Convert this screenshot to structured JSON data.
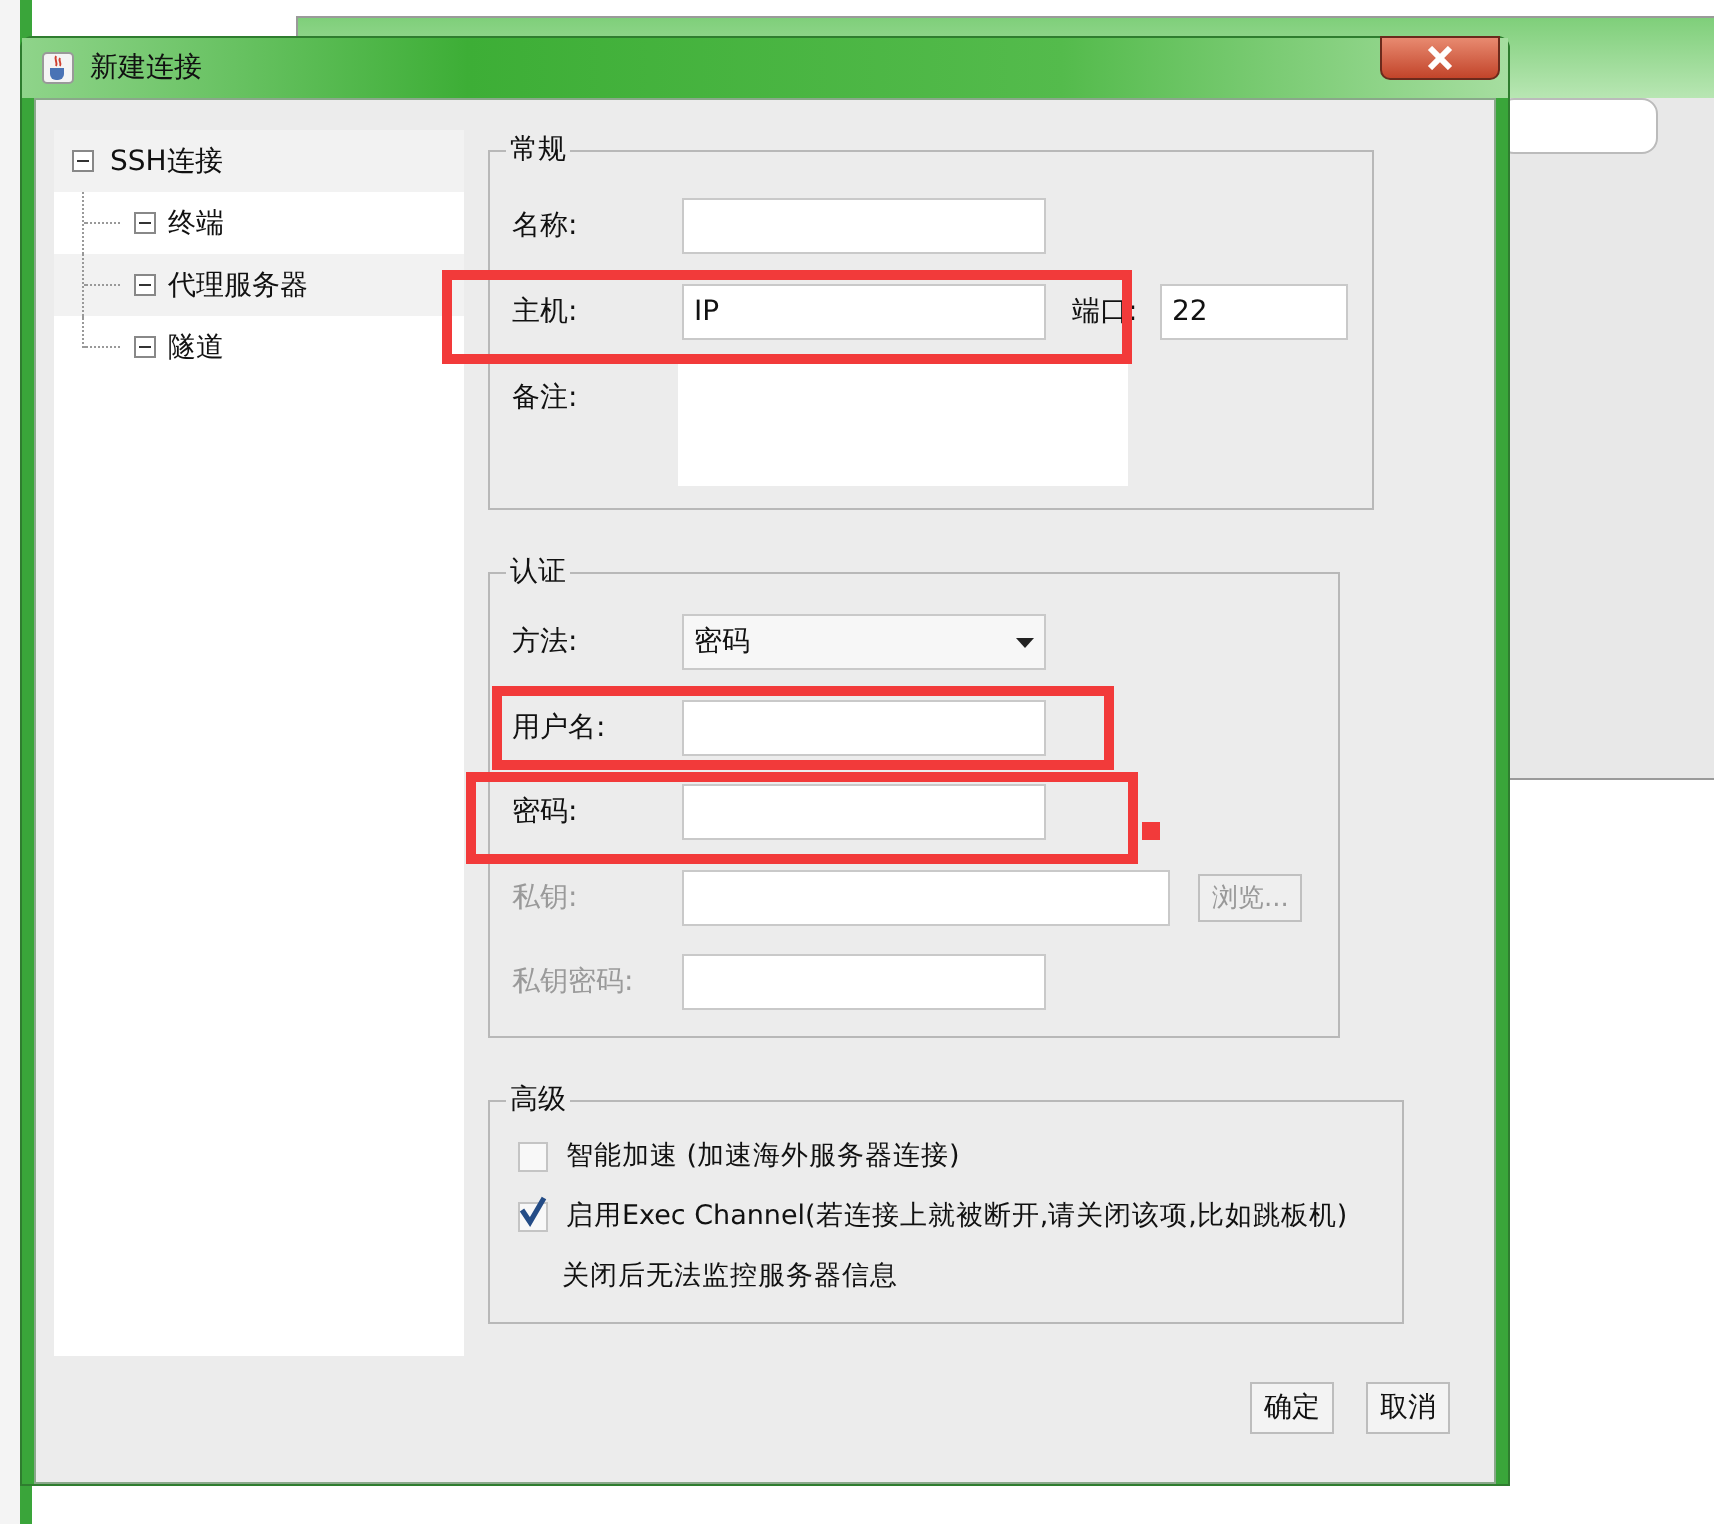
{
  "window": {
    "title": "新建连接"
  },
  "tree": [
    {
      "label": "SSH连接",
      "expanded": true,
      "children": [
        {
          "label": "终端",
          "expanded": true
        },
        {
          "label": "代理服务器",
          "expanded": true
        },
        {
          "label": "隧道",
          "expanded": true
        }
      ]
    }
  ],
  "groups": [
    {
      "title": "常规",
      "fields": [
        {
          "kind": "text",
          "label": "名称:",
          "disabled": false
        },
        {
          "kind": "host",
          "label": "主机:",
          "value": "IP",
          "port_label": "端口:",
          "port_value": "22",
          "disabled": false
        },
        {
          "kind": "textarea",
          "label": "备注:",
          "disabled": false
        }
      ]
    },
    {
      "title": "认证",
      "fields": [
        {
          "kind": "select",
          "label": "方法:",
          "value": "密码",
          "disabled": false
        },
        {
          "kind": "text",
          "label": "用户名:",
          "disabled": false
        },
        {
          "kind": "text",
          "label": "密码:",
          "disabled": false
        },
        {
          "kind": "file",
          "label": "私钥:",
          "button": "浏览...",
          "disabled": true
        },
        {
          "kind": "text",
          "label": "私钥密码:",
          "disabled": true
        }
      ]
    }
  ],
  "advanced": {
    "title": "高级",
    "options": [
      {
        "label": "智能加速 (加速海外服务器连接)",
        "checked": false
      },
      {
        "label": "启用Exec Channel(若连接上就被断开,请关闭该项,比如跳板机)",
        "checked": true
      }
    ],
    "note": "关闭后无法监控服务器信息"
  },
  "buttons": [
    "确定",
    "取消"
  ]
}
